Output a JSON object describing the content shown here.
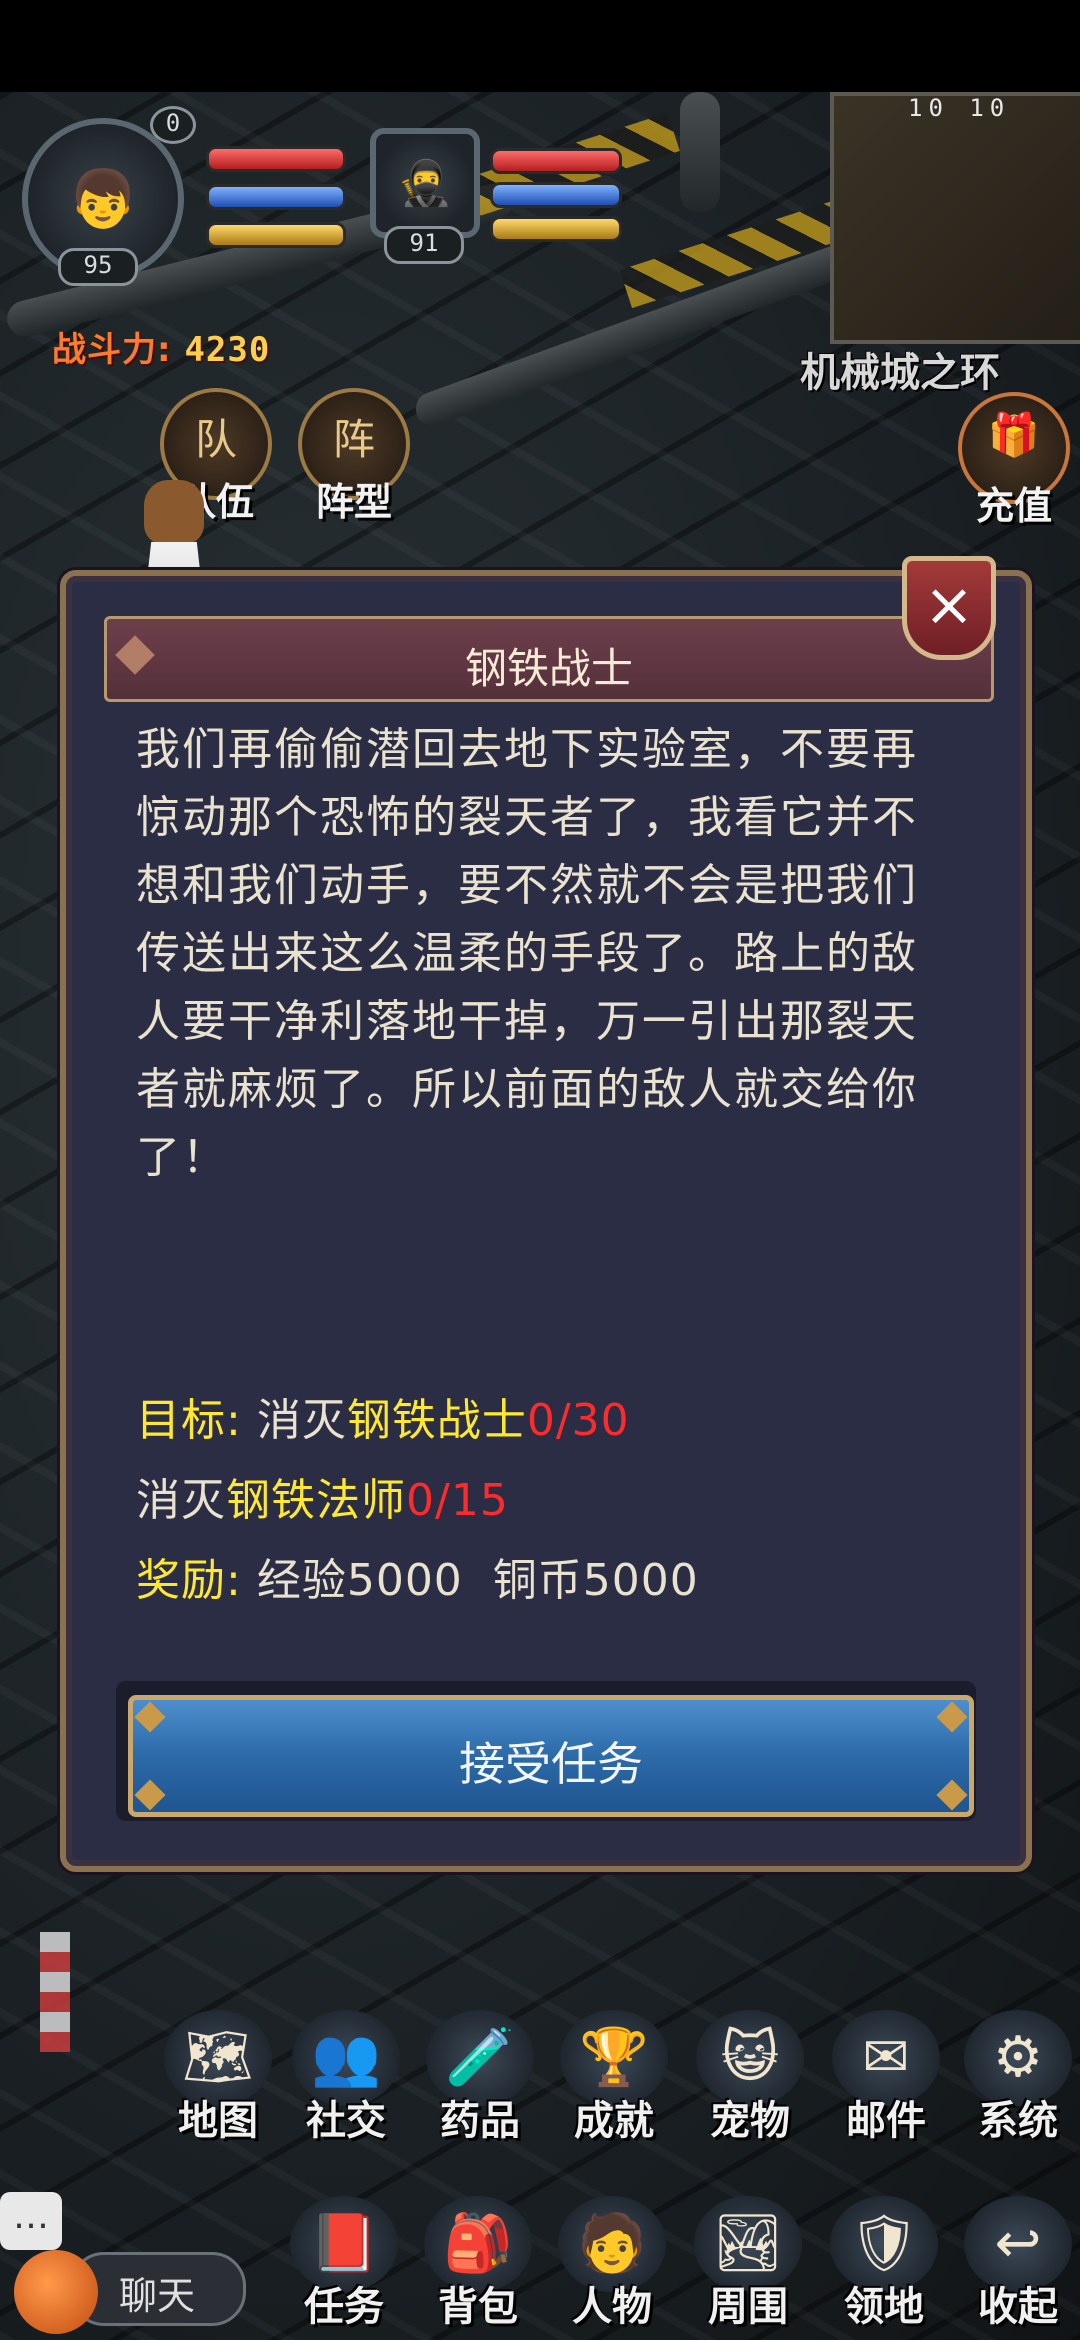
{
  "hud": {
    "player_level": "95",
    "player_badge": "0",
    "pet_level": "91",
    "power_label": "战斗力:",
    "power_value": "4230",
    "map_name": "机械城之环",
    "map_coords": "10 10"
  },
  "top_buttons": {
    "team_label": "队伍",
    "team_icon": "队",
    "formation_label": "阵型",
    "formation_icon": "阵",
    "recharge_label": "充值"
  },
  "dialog": {
    "title": "钢铁战士",
    "close_icon": "×",
    "body": "我们再偷偷潜回去地下实验室，不要再惊动那个恐怖的裂天者了，我看它并不想和我们动手，要不然就不会是把我们传送出来这么温柔的手段了。路上的敌人要干净利落地干掉，万一引出那裂天者就麻烦了。所以前面的敌人就交给你了！",
    "goal_label": "目标:",
    "goal_action1": "消灭",
    "goal_target1": "钢铁战士",
    "goal_progress1": "0/30",
    "goal_action2": "消灭",
    "goal_target2": "钢铁法师",
    "goal_progress2": "0/15",
    "reward_label": "奖励:",
    "reward_text": "经验5000  铜币5000",
    "accept_label": "接受任务"
  },
  "menu_row1": [
    {
      "label": "地图",
      "icon": "map-icon"
    },
    {
      "label": "社交",
      "icon": "social-icon"
    },
    {
      "label": "药品",
      "icon": "potion-icon"
    },
    {
      "label": "成就",
      "icon": "trophy-icon"
    },
    {
      "label": "宠物",
      "icon": "pet-icon"
    },
    {
      "label": "邮件",
      "icon": "mail-icon"
    },
    {
      "label": "系统",
      "icon": "gear-icon"
    }
  ],
  "menu_row2": [
    {
      "label": "任务",
      "icon": "quest-book-icon"
    },
    {
      "label": "背包",
      "icon": "backpack-icon"
    },
    {
      "label": "人物",
      "icon": "character-icon"
    },
    {
      "label": "周围",
      "icon": "surroundings-icon"
    },
    {
      "label": "领地",
      "icon": "territory-icon"
    },
    {
      "label": "收起",
      "icon": "collapse-icon"
    }
  ],
  "chat_label": "聊天",
  "colors": {
    "goal_label": "#ffe92e",
    "progress": "#ff2a2a",
    "dialog_bg": "#2a2d44",
    "title_bar": "#6d3f4b",
    "accept_button": "#2c6aa8"
  }
}
